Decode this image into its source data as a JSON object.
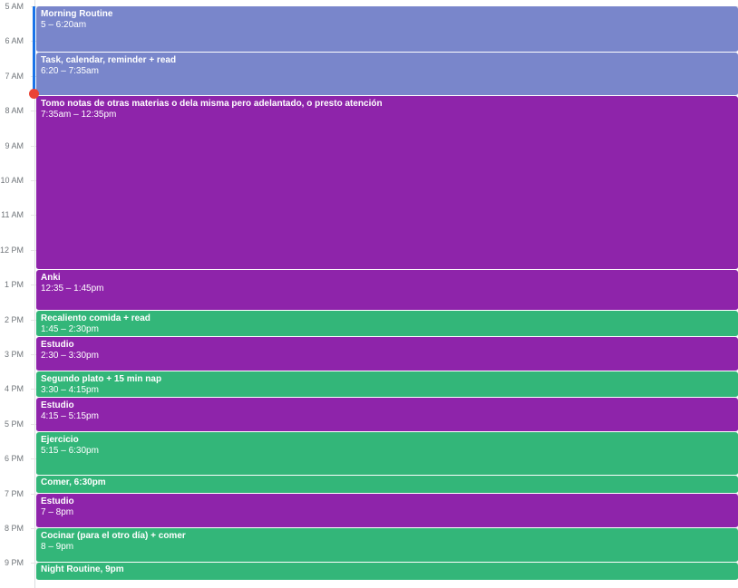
{
  "colors": {
    "lavender": "#7986cb",
    "grape": "#8e24aa",
    "basil": "#33b679",
    "now_indicator": "#ea4335",
    "current_time_bar": "#1a73e8"
  },
  "hour_labels": [
    "5 AM",
    "6 AM",
    "7 AM",
    "8 AM",
    "9 AM",
    "10 AM",
    "11 AM",
    "12 PM",
    "1 PM",
    "2 PM",
    "3 PM",
    "4 PM",
    "5 PM",
    "6 PM",
    "7 PM",
    "8 PM",
    "9 PM"
  ],
  "events": [
    {
      "title": "Morning Routine",
      "time": "5 – 6:20am",
      "color": "lavender",
      "start": "05:00",
      "end": "06:20"
    },
    {
      "title": "Task, calendar, reminder + read",
      "time": "6:20 – 7:35am",
      "color": "lavender",
      "start": "06:20",
      "end": "07:35"
    },
    {
      "title": "Tomo notas de otras materias o dela misma pero adelantado, o presto atención",
      "time": "7:35am – 12:35pm",
      "color": "grape",
      "start": "07:35",
      "end": "12:35"
    },
    {
      "title": "Anki",
      "time": "12:35 – 1:45pm",
      "color": "grape",
      "start": "12:35",
      "end": "13:45"
    },
    {
      "title": "Recaliento comida + read",
      "time": "1:45 – 2:30pm",
      "color": "basil",
      "start": "13:45",
      "end": "14:30"
    },
    {
      "title": "Estudio",
      "time": "2:30 – 3:30pm",
      "color": "grape",
      "start": "14:30",
      "end": "15:30"
    },
    {
      "title": "Segundo plato + 15 min nap",
      "time": "3:30 – 4:15pm",
      "color": "basil",
      "start": "15:30",
      "end": "16:15"
    },
    {
      "title": "Estudio",
      "time": "4:15 – 5:15pm",
      "color": "grape",
      "start": "16:15",
      "end": "17:15"
    },
    {
      "title": "Ejercicio",
      "time": "5:15 – 6:30pm",
      "color": "basil",
      "start": "17:15",
      "end": "18:30"
    },
    {
      "inline": "Comer, 6:30pm",
      "color": "basil",
      "start": "18:30",
      "end": "19:00"
    },
    {
      "title": "Estudio",
      "time": "7 – 8pm",
      "color": "grape",
      "start": "19:00",
      "end": "20:00"
    },
    {
      "title": "Cocinar (para el otro día) + comer",
      "time": "8 – 9pm",
      "color": "basil",
      "start": "20:00",
      "end": "21:00"
    },
    {
      "inline": "Night Routine, 9pm",
      "color": "basil",
      "start": "21:00",
      "end": "21:30"
    }
  ],
  "current_time": "07:30"
}
